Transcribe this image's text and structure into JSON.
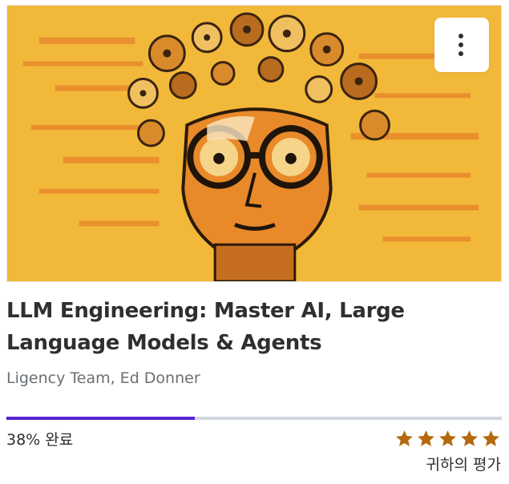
{
  "course": {
    "title": "LLM Engineering: Master AI, Large Language Models & Agents",
    "instructors": "Ligency Team, Ed Donner",
    "image_icon": "course-thumbnail-illustration",
    "menu_icon": "more-vertical-icon"
  },
  "progress": {
    "percent": 38,
    "label": "38% 완료"
  },
  "rating": {
    "stars": 5,
    "label": "귀하의 평가"
  },
  "colors": {
    "accent": "#5624d0",
    "star": "#b4690e",
    "thumbnail_bg": "#f2b83a",
    "text": "#2d2f31",
    "muted": "#6a6f73"
  }
}
